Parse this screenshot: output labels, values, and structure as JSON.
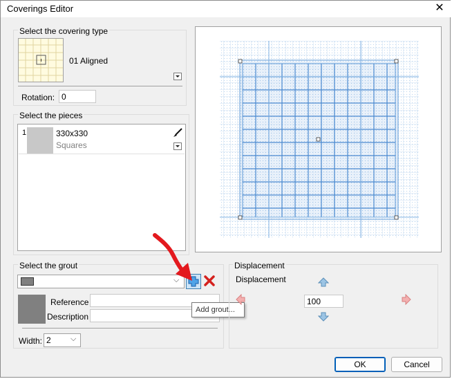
{
  "window": {
    "title": "Coverings Editor"
  },
  "covering_type": {
    "group_label": "Select the covering type",
    "selected": "01 Aligned",
    "rotation_label": "Rotation:",
    "rotation_value": "0"
  },
  "pieces": {
    "group_label": "Select the pieces",
    "items": [
      {
        "index": "1",
        "size": "330x330",
        "shape": "Squares"
      }
    ]
  },
  "grout": {
    "group_label": "Select the grout",
    "reference_label": "Reference",
    "reference_value": "",
    "description_label": "Description",
    "description_value": "",
    "width_label": "Width:",
    "width_value": "2",
    "tooltip": "Add grout..."
  },
  "displacement": {
    "group_label": "Displacement",
    "inner_label": "Displacement",
    "value": "100"
  },
  "buttons": {
    "ok": "OK",
    "cancel": "Cancel"
  },
  "colors": {
    "accent": "#1a73c8",
    "grout": "#808080",
    "arrow": "#e3191e"
  }
}
